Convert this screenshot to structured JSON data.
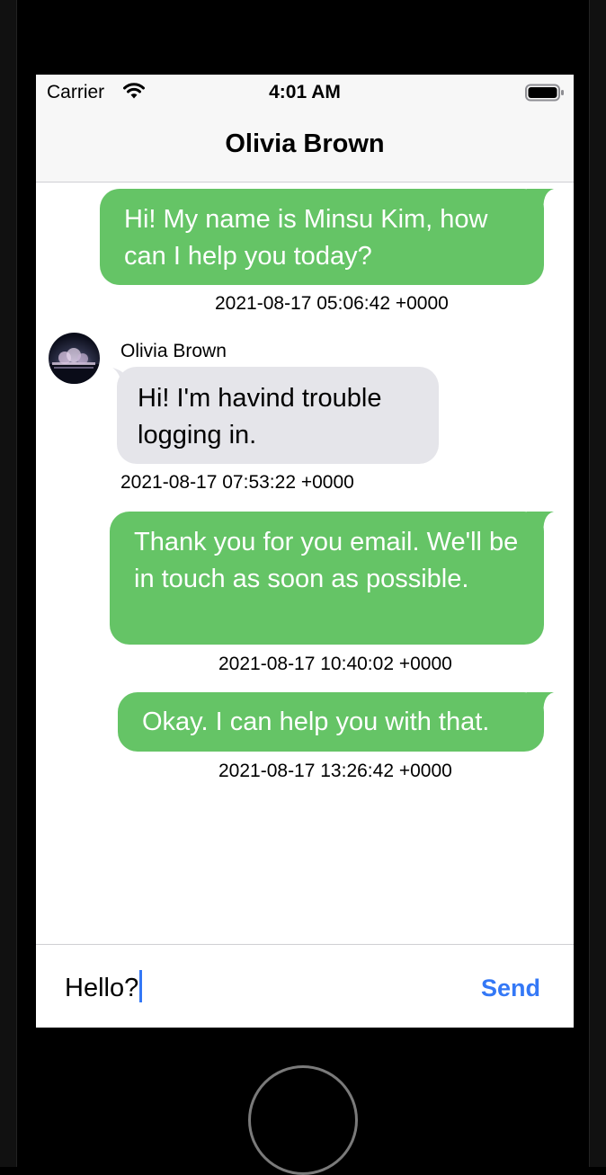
{
  "status_bar": {
    "carrier": "Carrier",
    "time": "4:01 AM"
  },
  "nav": {
    "title": "Olivia Brown"
  },
  "messages": [
    {
      "direction": "outgoing",
      "text": "Hi! My name is Minsu Kim, how can I help you today?",
      "timestamp": "2021-08-17 05:06:42 +0000"
    },
    {
      "direction": "incoming",
      "sender": "Olivia Brown",
      "text": "Hi! I'm havind trouble logging in.",
      "timestamp": "2021-08-17 07:53:22 +0000"
    },
    {
      "direction": "outgoing",
      "text": "Thank you for you email. We'll be in touch as soon as possible.",
      "timestamp": "2021-08-17 10:40:02 +0000"
    },
    {
      "direction": "outgoing",
      "text": "Okay. I can help you with that.",
      "timestamp": "2021-08-17 13:26:42 +0000"
    }
  ],
  "input": {
    "value": "Hello?"
  },
  "send_label": "Send",
  "colors": {
    "outgoing_bubble": "#65c466",
    "incoming_bubble": "#e5e5ea",
    "accent": "#3478f6"
  }
}
